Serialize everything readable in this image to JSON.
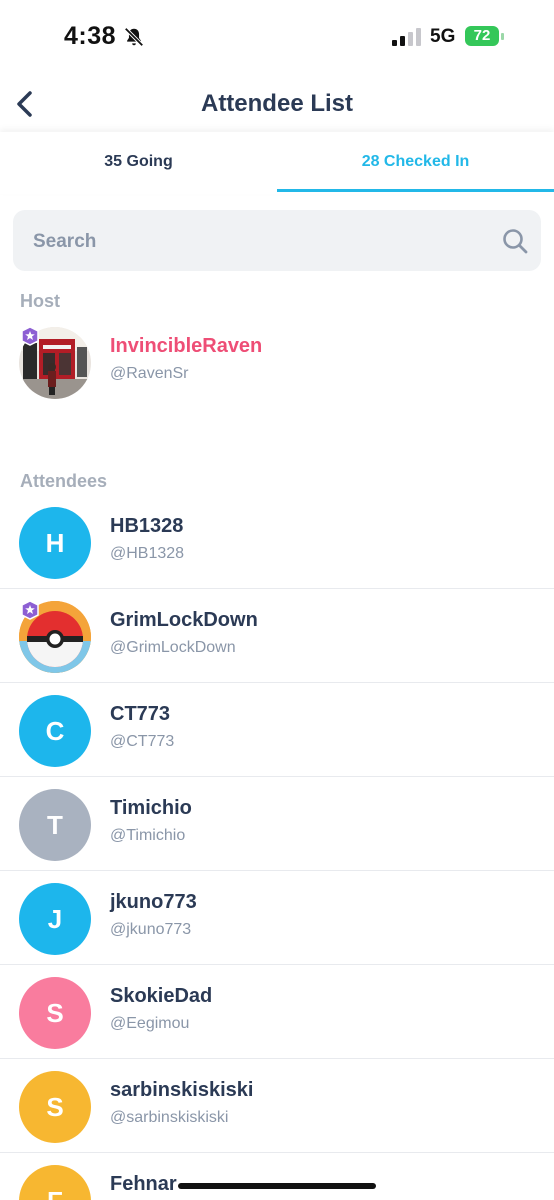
{
  "status_bar": {
    "time": "4:38",
    "network": "5G",
    "battery": "72",
    "icons": [
      "bell-muted-icon",
      "signal-bars-icon",
      "battery-icon"
    ]
  },
  "header": {
    "title": "Attendee List",
    "back_icon": "chevron-left-icon"
  },
  "tabs": [
    {
      "label": "35 Going",
      "active": false
    },
    {
      "label": "28 Checked In",
      "active": true
    }
  ],
  "search": {
    "placeholder": "Search",
    "value": "",
    "icon": "search-icon"
  },
  "host_section": {
    "label": "Host",
    "host": {
      "name": "InvincibleRaven",
      "handle": "@RavenSr",
      "photo": "storefront-photo",
      "badge": "star-badge-icon"
    }
  },
  "attendees_section": {
    "label": "Attendees",
    "items": [
      {
        "name": "HB1328",
        "handle": "@HB1328",
        "initial": "H",
        "color": "#1db6ec"
      },
      {
        "name": "GrimLockDown",
        "handle": "@GrimLockDown",
        "initial": "",
        "color": "#f4a43a",
        "photo": "pokeball-photo",
        "badge": "star-badge-icon"
      },
      {
        "name": "CT773",
        "handle": "@CT773",
        "initial": "C",
        "color": "#1db6ec"
      },
      {
        "name": "Timichio",
        "handle": "@Timichio",
        "initial": "T",
        "color": "#a9b2c0"
      },
      {
        "name": "jkuno773",
        "handle": "@jkuno773",
        "initial": "J",
        "color": "#1db6ec"
      },
      {
        "name": "SkokieDad",
        "handle": "@Eegimou",
        "initial": "S",
        "color": "#f97c9e"
      },
      {
        "name": "sarbinskiskiski",
        "handle": "@sarbinskiskiski",
        "initial": "S",
        "color": "#f7b731"
      },
      {
        "name": "Fehnar",
        "handle": "",
        "initial": "F",
        "color": "#f7b731"
      }
    ]
  },
  "colors": {
    "accent": "#22b8e8",
    "host_name": "#ee4e76",
    "text": "#2b3a55",
    "muted": "#8a96a8",
    "section_label": "#a6aeba"
  }
}
